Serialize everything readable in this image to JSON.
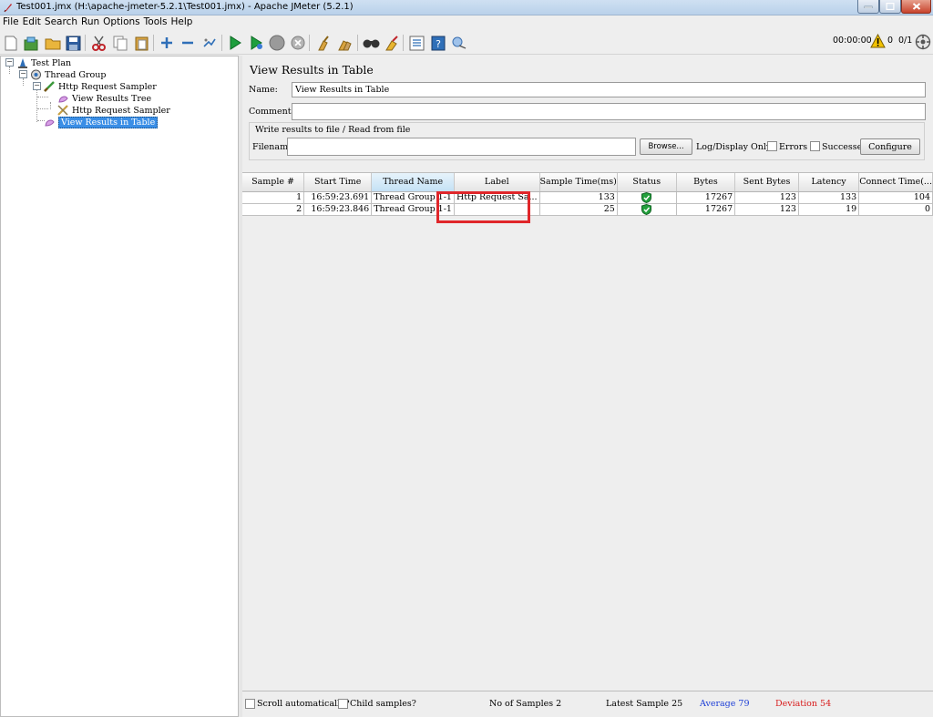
{
  "window": {
    "title": "Test001.jmx (H:\\apache-jmeter-5.2.1\\Test001.jmx) - Apache JMeter (5.2.1)"
  },
  "menu": [
    "File",
    "Edit",
    "Search",
    "Run",
    "Options",
    "Tools",
    "Help"
  ],
  "toolbar": {
    "icons": [
      "new-icon",
      "templates-icon",
      "open-icon",
      "save-icon",
      "cut-icon",
      "copy-icon",
      "paste-icon",
      "expand-icon",
      "collapse-icon",
      "toggle-icon",
      "start-icon",
      "start-no-pause-icon",
      "stop-icon",
      "shutdown-icon",
      "clear-icon",
      "clear-all-icon",
      "search-icon",
      "reset-search-icon",
      "function-helper-icon",
      "help-icon",
      "remote-start-icon"
    ],
    "timer": "00:00:00",
    "warnings": "0",
    "threads": "0/1"
  },
  "tree": {
    "nodes": [
      {
        "label": "Test Plan",
        "icon": "test-plan-icon"
      },
      {
        "label": "Thread Group",
        "icon": "thread-group-icon"
      },
      {
        "label": "Http Request Sampler",
        "icon": "sampler-icon"
      },
      {
        "label": "View Results Tree",
        "icon": "listener-icon"
      },
      {
        "label": "Http Request Sampler",
        "icon": "disabled-sampler-icon"
      },
      {
        "label": "View Results in Table",
        "icon": "listener-icon"
      }
    ]
  },
  "panel": {
    "title": "View Results in Table",
    "name_label": "Name:",
    "name_value": "View Results in Table",
    "comments_label": "Comments:",
    "comments_value": "",
    "file_group_title": "Write results to file / Read from file",
    "filename_label": "Filename",
    "filename_value": "",
    "browse_label": "Browse...",
    "log_display_label": "Log/Display Only:",
    "errors_label": "Errors",
    "successes_label": "Successes",
    "configure_label": "Configure"
  },
  "table": {
    "columns": [
      "Sample #",
      "Start Time",
      "Thread Name",
      "Label",
      "Sample Time(ms)",
      "Status",
      "Bytes",
      "Sent Bytes",
      "Latency",
      "Connect Time(..."
    ],
    "sorted_column": "Thread Name",
    "rows": [
      [
        "1",
        "16:59:23.691",
        "Thread Group 1-1",
        "Http Request Sa...",
        "133",
        "success",
        "17267",
        "123",
        "133",
        "104"
      ],
      [
        "2",
        "16:59:23.846",
        "Thread Group 1-1",
        "",
        "25",
        "success",
        "17267",
        "123",
        "19",
        "0"
      ]
    ]
  },
  "statusbar": {
    "scroll_label": "Scroll automatically?",
    "child_label": "Child samples?",
    "samples_label": "No of Samples",
    "samples_value": "2",
    "latest_label": "Latest Sample",
    "latest_value": "25",
    "average_label": "Average",
    "average_value": "79",
    "deviation_label": "Deviation",
    "deviation_value": "54"
  },
  "colors": {
    "average": "#1a3cd6",
    "deviation": "#d81b1b",
    "selection": "#3a8ee6",
    "highlight_box": "#e0262a"
  }
}
